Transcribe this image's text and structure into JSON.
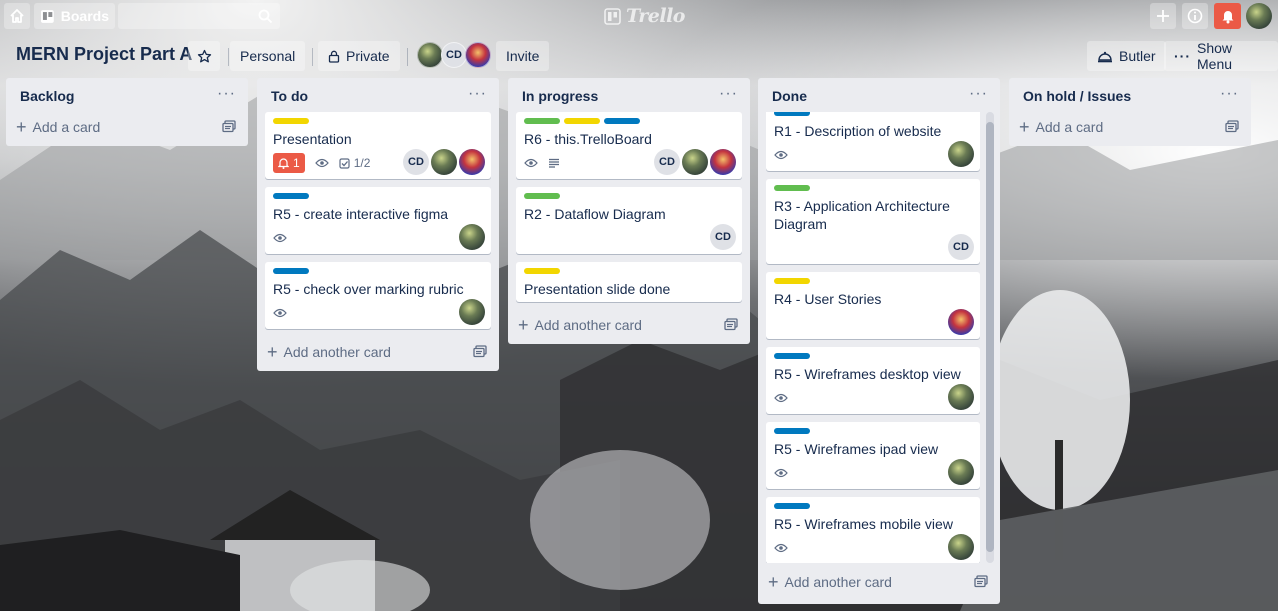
{
  "topbar": {
    "boards_label": "Boards",
    "logo_text": "Trello"
  },
  "board": {
    "title": "MERN Project Part A",
    "team_label": "Personal",
    "visibility_label": "Private",
    "invite_label": "Invite",
    "butler_label": "Butler",
    "menu_label": "Show Menu",
    "member_initials": "CD"
  },
  "lists": [
    {
      "title": "Backlog",
      "add_label": "Add a card",
      "cards": []
    },
    {
      "title": "To do",
      "add_label": "Add another card",
      "cards": [
        {
          "title": "Presentation",
          "labels": [
            "yellow"
          ],
          "due_count": "1",
          "checklist": "1/2",
          "members": [
            "CD",
            "p1",
            "p2"
          ]
        },
        {
          "title": "R5 - create interactive figma",
          "labels": [
            "blue"
          ],
          "members": [
            "p1"
          ]
        },
        {
          "title": "R5 - check over marking rubric",
          "labels": [
            "blue"
          ],
          "members": [
            "p1"
          ]
        }
      ]
    },
    {
      "title": "In progress",
      "add_label": "Add another card",
      "cards": [
        {
          "title": "R6 - this.TrelloBoard",
          "labels": [
            "green",
            "yellow",
            "blue"
          ],
          "members": [
            "CD",
            "p1",
            "p2"
          ]
        },
        {
          "title": "R2 - Dataflow Diagram",
          "labels": [
            "green"
          ],
          "members": [
            "CD"
          ]
        },
        {
          "title": "Presentation slide done",
          "labels": [
            "yellow"
          ],
          "members": []
        }
      ]
    },
    {
      "title": "Done",
      "add_label": "Add another card",
      "cards": [
        {
          "title": "R1 - Description of website",
          "labels": [
            "blue"
          ],
          "members": [
            "p1"
          ]
        },
        {
          "title": "R3 - Application Architecture Diagram",
          "labels": [
            "green"
          ],
          "members": [
            "CD"
          ]
        },
        {
          "title": "R4 - User Stories",
          "labels": [
            "yellow"
          ],
          "members": [
            "p2"
          ]
        },
        {
          "title": "R5 - Wireframes desktop view",
          "labels": [
            "blue"
          ],
          "members": [
            "p1"
          ]
        },
        {
          "title": "R5 - Wireframes ipad view",
          "labels": [
            "blue"
          ],
          "members": [
            "p1"
          ]
        },
        {
          "title": "R5 - Wireframes mobile view",
          "labels": [
            "blue"
          ],
          "members": [
            "p1"
          ]
        }
      ]
    },
    {
      "title": "On hold / Issues",
      "add_label": "Add a card",
      "cards": []
    }
  ]
}
